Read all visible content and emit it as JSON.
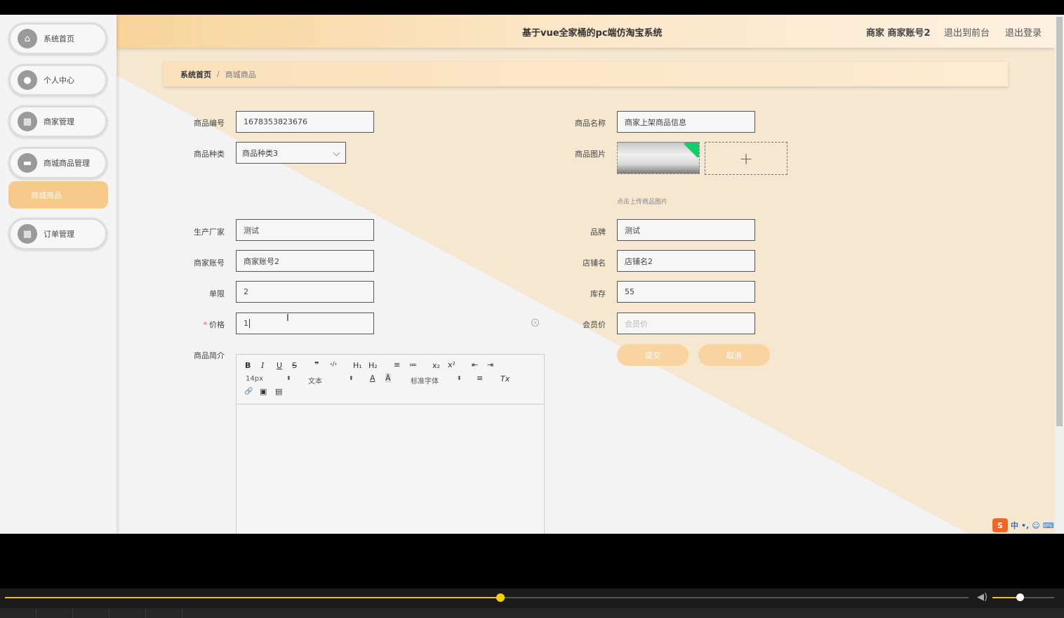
{
  "header": {
    "title": "基于vue全家桶的pc端仿淘宝系统",
    "user": "商家 商家账号2",
    "back_to_front": "退出到前台",
    "logout": "退出登录"
  },
  "sidebar": {
    "items": [
      {
        "label": "系统首页",
        "icon": "home-icon"
      },
      {
        "label": "个人中心",
        "icon": "user-icon"
      },
      {
        "label": "商家管理",
        "icon": "grid-icon"
      },
      {
        "label": "商城商品管理",
        "icon": "briefcase-icon"
      },
      {
        "label": "订单管理",
        "icon": "grid-icon"
      }
    ],
    "sub_active": "商城商品"
  },
  "breadcrumb": {
    "home": "系统首页",
    "separator": "/",
    "current": "商城商品"
  },
  "form": {
    "code_label": "商品编号",
    "code_value": "1678353823676",
    "name_label": "商品名称",
    "name_value": "商家上架商品信息",
    "category_label": "商品种类",
    "category_value": "商品种类3",
    "image_label": "商品图片",
    "upload_tip": "点击上传商品图片",
    "upload_plus": "+",
    "maker_label": "生产厂家",
    "maker_value": "测试",
    "brand_label": "品牌",
    "brand_value": "测试",
    "merchant_label": "商家账号",
    "merchant_value": "商家账号2",
    "shop_label": "店铺名",
    "shop_value": "店铺名2",
    "limit_label": "单限",
    "limit_value": "2",
    "stock_label": "库存",
    "stock_value": "55",
    "price_required": "*",
    "price_label": "价格",
    "price_value": "1",
    "member_price_label": "会员价",
    "member_price_placeholder": "会员价",
    "intro_label": "商品简介",
    "submit": "提交",
    "cancel": "取消"
  },
  "editor": {
    "font_size": "14px",
    "block_type": "文本",
    "font_family": "标准字体",
    "toolbar_row1": [
      "B",
      "I",
      "U",
      "S",
      "❞",
      "‹/›",
      "H₁",
      "H₂",
      "≡",
      "≔",
      "x₂",
      "x²",
      "⇤",
      "⇥"
    ],
    "toolbar_row2_icons": [
      "A",
      "Ā",
      "≡",
      "Tx"
    ],
    "toolbar_row3_icons": [
      "🔗",
      "▣",
      "▤"
    ]
  },
  "ime": {
    "logo": "S",
    "mode": "中",
    "punct": "•,"
  },
  "player": {
    "progress": 0.514,
    "volume": 0.44
  },
  "colors": {
    "accent": "#f7c98a",
    "button": "#f9d4a0",
    "seek": "#f2c200"
  }
}
